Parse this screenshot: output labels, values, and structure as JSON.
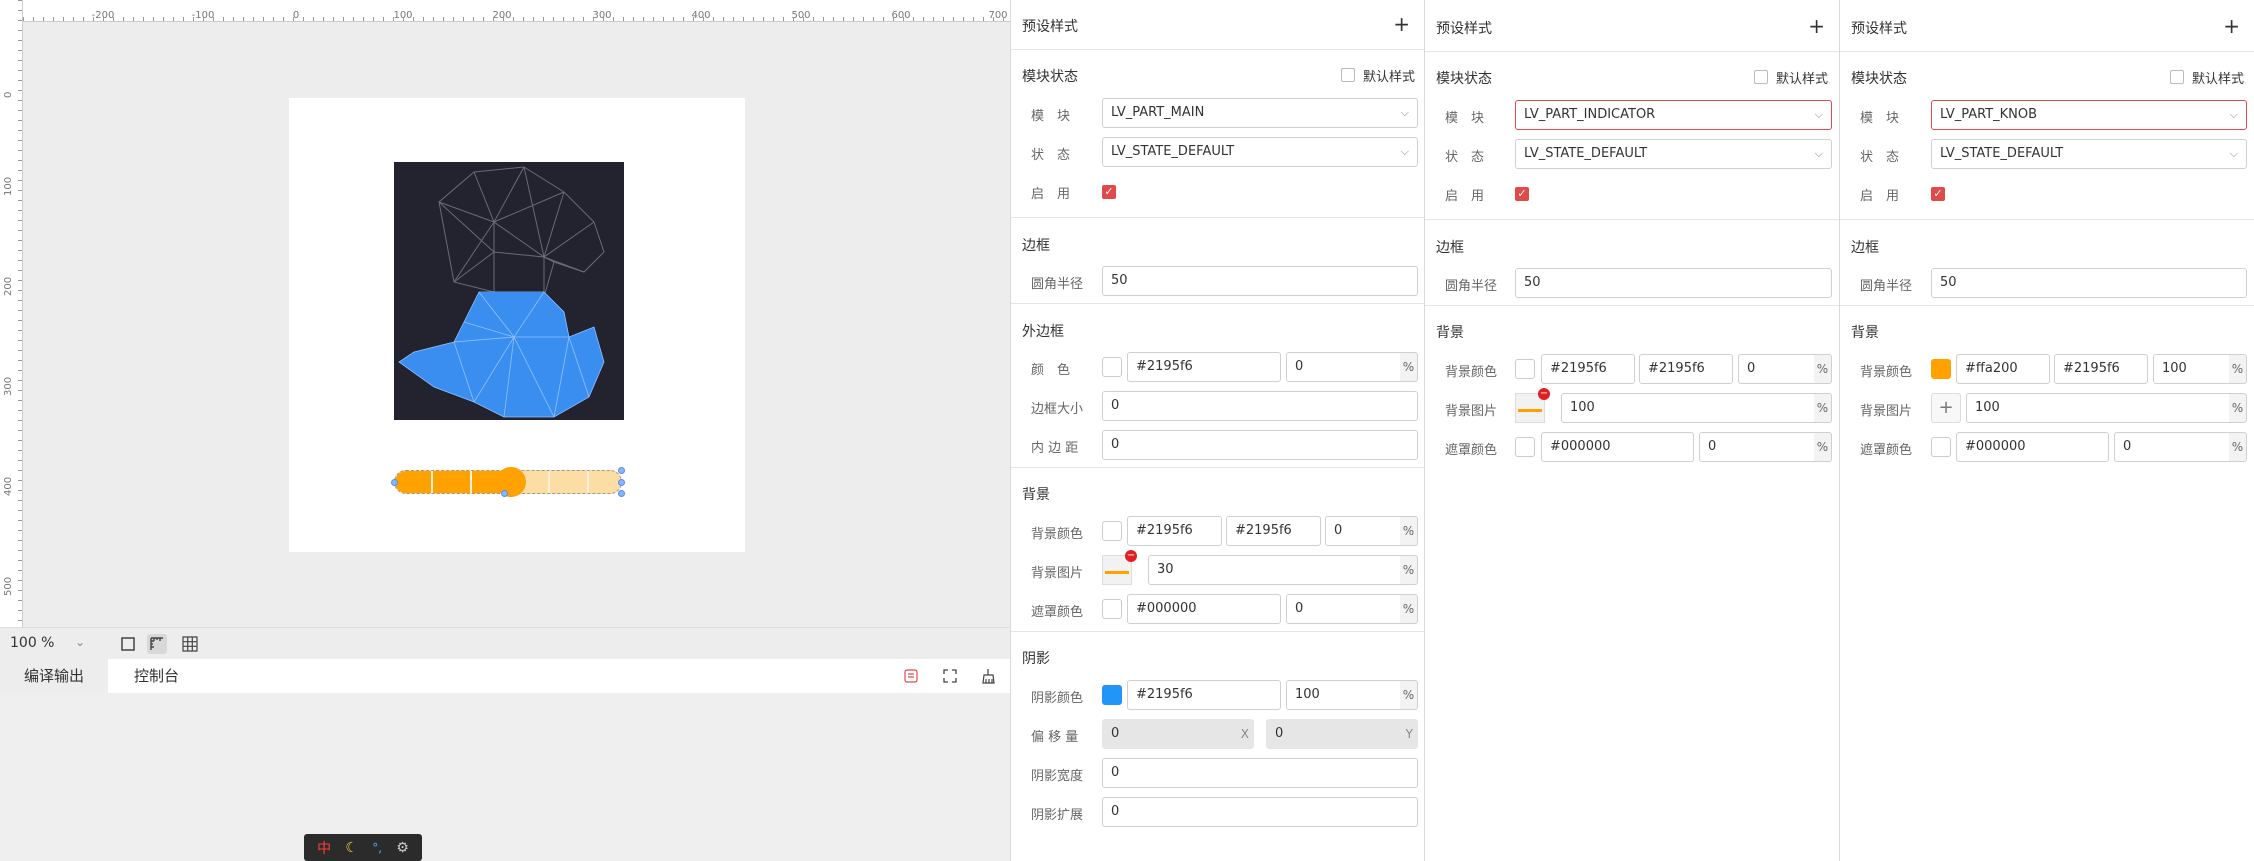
{
  "ruler": {
    "x_labels": [
      "-200",
      "-100",
      "0",
      "100",
      "200",
      "300",
      "400",
      "500",
      "600",
      "700"
    ],
    "y_labels": [
      "0",
      "100",
      "200",
      "300",
      "400",
      "500"
    ]
  },
  "editor": {
    "zoom": "100 %",
    "tabs": {
      "compile_output": "编译输出",
      "console": "控制台"
    },
    "ime": {
      "zh": "中",
      "moon": "☾",
      "punct": "°,",
      "gear": "⚙"
    }
  },
  "colors": {
    "accent": "#e04a4a",
    "indicator": "#ffa200",
    "slider_bg": "#fcdda4",
    "shadow_swatch": "#2196f6",
    "image_bg": "#23222f"
  },
  "panels": [
    {
      "title": "预设样式",
      "plus": "+",
      "state_label": "模块状态",
      "default_style": "默认样式",
      "part_label": "模　块",
      "part": "LV_PART_MAIN",
      "status_label": "状　态",
      "status": "LV_STATE_DEFAULT",
      "enable_label": "启　用",
      "border_section": "边框",
      "radius_label": "圆角半径",
      "radius": "50",
      "outline_section": "外边框",
      "outline_color_label": "颜　色",
      "outline_color": "#2195f6",
      "outline_opa": "0",
      "outline_width_label": "边框大小",
      "outline_width": "0",
      "outline_pad_label": "内 边 距",
      "outline_pad": "0",
      "bg_section": "背景",
      "bg_color_label": "背景颜色",
      "bg_color": "#2195f6",
      "bg_grad": "#2195f6",
      "bg_opa": "0",
      "bg_img_label": "背景图片",
      "bg_img_opa": "30",
      "mask_label": "遮罩颜色",
      "mask_color": "#000000",
      "mask_opa": "0",
      "shadow_section": "阴影",
      "shadow_color_label": "阴影颜色",
      "shadow_color": "#2195f6",
      "shadow_opa": "100",
      "offset_label": "偏 移 量",
      "offset_x": "0",
      "offset_x_unit": "X",
      "offset_y": "0",
      "offset_y_unit": "Y",
      "shadow_width_label": "阴影宽度",
      "shadow_width": "0",
      "shadow_spread_label": "阴影扩展",
      "shadow_spread": "0",
      "pct": "%"
    },
    {
      "title": "预设样式",
      "plus": "+",
      "state_label": "模块状态",
      "default_style": "默认样式",
      "part_label": "模　块",
      "part": "LV_PART_INDICATOR",
      "status_label": "状　态",
      "status": "LV_STATE_DEFAULT",
      "enable_label": "启　用",
      "border_section": "边框",
      "radius_label": "圆角半径",
      "radius": "50",
      "bg_section": "背景",
      "bg_color_label": "背景颜色",
      "bg_color": "#2195f6",
      "bg_grad": "#2195f6",
      "bg_opa": "0",
      "bg_img_label": "背景图片",
      "bg_img_opa": "100",
      "mask_label": "遮罩颜色",
      "mask_color": "#000000",
      "mask_opa": "0",
      "pct": "%"
    },
    {
      "title": "预设样式",
      "plus": "+",
      "state_label": "模块状态",
      "default_style": "默认样式",
      "part_label": "模　块",
      "part": "LV_PART_KNOB",
      "status_label": "状　态",
      "status": "LV_STATE_DEFAULT",
      "enable_label": "启　用",
      "border_section": "边框",
      "radius_label": "圆角半径",
      "radius": "50",
      "bg_section": "背景",
      "bg_color_label": "背景颜色",
      "bg_color": "#ffa200",
      "bg_grad": "#2195f6",
      "bg_opa": "100",
      "bg_img_label": "背景图片",
      "bg_img_opa": "100",
      "bg_img_plus": "+",
      "mask_label": "遮罩颜色",
      "mask_color": "#000000",
      "mask_opa": "0",
      "pct": "%"
    }
  ]
}
